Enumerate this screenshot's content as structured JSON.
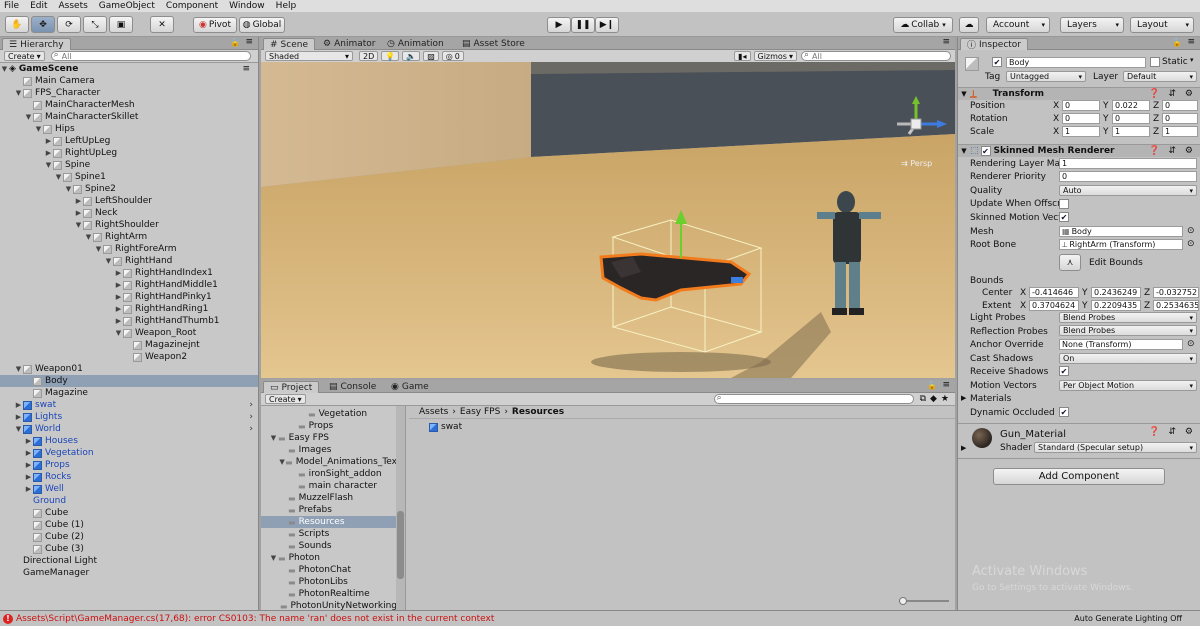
{
  "menu": [
    "File",
    "Edit",
    "Assets",
    "GameObject",
    "Component",
    "Window",
    "Help"
  ],
  "toolbar": {
    "pivot": "Pivot",
    "global": "Global",
    "collab": "Collab",
    "account": "Account",
    "layers": "Layers",
    "layout": "Layout"
  },
  "hierarchy": {
    "tab": "Hierarchy",
    "create": "Create",
    "search_placeholder": "All",
    "scene_name": "GameScene",
    "items": [
      {
        "label": "Main Camera",
        "depth": 1,
        "arrow": "",
        "blue": false
      },
      {
        "label": "FPS_Character",
        "depth": 1,
        "arrow": "▼",
        "blue": false
      },
      {
        "label": "MainCharacterMesh",
        "depth": 2,
        "arrow": "",
        "blue": false
      },
      {
        "label": "MainCharacterSkillet",
        "depth": 2,
        "arrow": "▼",
        "blue": false
      },
      {
        "label": "Hips",
        "depth": 3,
        "arrow": "▼",
        "blue": false
      },
      {
        "label": "LeftUpLeg",
        "depth": 4,
        "arrow": "▶",
        "blue": false
      },
      {
        "label": "RightUpLeg",
        "depth": 4,
        "arrow": "▶",
        "blue": false
      },
      {
        "label": "Spine",
        "depth": 4,
        "arrow": "▼",
        "blue": false
      },
      {
        "label": "Spine1",
        "depth": 5,
        "arrow": "▼",
        "blue": false
      },
      {
        "label": "Spine2",
        "depth": 6,
        "arrow": "▼",
        "blue": false
      },
      {
        "label": "LeftShoulder",
        "depth": 7,
        "arrow": "▶",
        "blue": false
      },
      {
        "label": "Neck",
        "depth": 7,
        "arrow": "▶",
        "blue": false
      },
      {
        "label": "RightShoulder",
        "depth": 7,
        "arrow": "▼",
        "blue": false
      },
      {
        "label": "RightArm",
        "depth": 8,
        "arrow": "▼",
        "blue": false
      },
      {
        "label": "RightForeArm",
        "depth": 9,
        "arrow": "▼",
        "blue": false
      },
      {
        "label": "RightHand",
        "depth": 10,
        "arrow": "▼",
        "blue": false
      },
      {
        "label": "RightHandIndex1",
        "depth": 11,
        "arrow": "▶",
        "blue": false
      },
      {
        "label": "RightHandMiddle1",
        "depth": 11,
        "arrow": "▶",
        "blue": false
      },
      {
        "label": "RightHandPinky1",
        "depth": 11,
        "arrow": "▶",
        "blue": false
      },
      {
        "label": "RightHandRing1",
        "depth": 11,
        "arrow": "▶",
        "blue": false
      },
      {
        "label": "RightHandThumb1",
        "depth": 11,
        "arrow": "▶",
        "blue": false
      },
      {
        "label": "Weapon_Root",
        "depth": 11,
        "arrow": "▼",
        "blue": false
      },
      {
        "label": "Magazinejnt",
        "depth": 12,
        "arrow": "",
        "blue": false
      },
      {
        "label": "Weapon2",
        "depth": 12,
        "arrow": "",
        "blue": false
      },
      {
        "label": "Weapon01",
        "depth": 1,
        "arrow": "▼",
        "blue": false
      },
      {
        "label": "Body",
        "depth": 2,
        "arrow": "",
        "blue": false,
        "selected": true
      },
      {
        "label": "Magazine",
        "depth": 2,
        "arrow": "",
        "blue": false
      },
      {
        "label": "swat",
        "depth": 1,
        "arrow": "▶",
        "blue": true,
        "chev": true
      },
      {
        "label": "Lights",
        "depth": 1,
        "arrow": "▶",
        "blue": true,
        "chev": true
      },
      {
        "label": "World",
        "depth": 1,
        "arrow": "▼",
        "blue": true,
        "chev": true
      },
      {
        "label": "Houses",
        "depth": 2,
        "arrow": "▶",
        "blue": true
      },
      {
        "label": "Vegetation",
        "depth": 2,
        "arrow": "▶",
        "blue": true
      },
      {
        "label": "Props",
        "depth": 2,
        "arrow": "▶",
        "blue": true
      },
      {
        "label": "Rocks",
        "depth": 2,
        "arrow": "▶",
        "blue": true
      },
      {
        "label": "Well",
        "depth": 2,
        "arrow": "▶",
        "blue": true
      },
      {
        "label": "Ground",
        "depth": 2,
        "arrow": "",
        "blue": true,
        "nocube": true
      },
      {
        "label": "Cube",
        "depth": 2,
        "arrow": "",
        "blue": false
      },
      {
        "label": "Cube (1)",
        "depth": 2,
        "arrow": "",
        "blue": false
      },
      {
        "label": "Cube (2)",
        "depth": 2,
        "arrow": "",
        "blue": false
      },
      {
        "label": "Cube (3)",
        "depth": 2,
        "arrow": "",
        "blue": false
      },
      {
        "label": "Directional Light",
        "depth": 1,
        "arrow": "",
        "blue": false,
        "nocube": true
      },
      {
        "label": "GameManager",
        "depth": 1,
        "arrow": "",
        "blue": false,
        "nocube": true
      }
    ]
  },
  "scene": {
    "tabs": [
      "Scene",
      "Animator",
      "Animation",
      "Asset Store"
    ],
    "shading": "Shaded",
    "mode_2d": "2D",
    "effects_count": "0",
    "gizmos": "Gizmos",
    "search_placeholder": "All",
    "persp_label": "Persp"
  },
  "project": {
    "tabs": [
      "Project",
      "Console",
      "Game"
    ],
    "create": "Create",
    "breadcrumb": [
      "Assets",
      "Easy FPS",
      "Resources"
    ],
    "tree": [
      {
        "label": "Vegetation",
        "depth": 3,
        "arrow": ""
      },
      {
        "label": "Props",
        "depth": 2,
        "arrow": ""
      },
      {
        "label": "Easy FPS",
        "depth": 0,
        "arrow": "▼"
      },
      {
        "label": "Images",
        "depth": 1,
        "arrow": ""
      },
      {
        "label": "Model_Animations_Tex",
        "depth": 1,
        "arrow": "▼"
      },
      {
        "label": "ironSight_addon",
        "depth": 2,
        "arrow": ""
      },
      {
        "label": "main character",
        "depth": 2,
        "arrow": ""
      },
      {
        "label": "MuzzelFlash",
        "depth": 1,
        "arrow": ""
      },
      {
        "label": "Prefabs",
        "depth": 1,
        "arrow": ""
      },
      {
        "label": "Resources",
        "depth": 1,
        "arrow": "",
        "selected": true
      },
      {
        "label": "Scripts",
        "depth": 1,
        "arrow": ""
      },
      {
        "label": "Sounds",
        "depth": 1,
        "arrow": ""
      },
      {
        "label": "Photon",
        "depth": 0,
        "arrow": "▼"
      },
      {
        "label": "PhotonChat",
        "depth": 1,
        "arrow": ""
      },
      {
        "label": "PhotonLibs",
        "depth": 1,
        "arrow": ""
      },
      {
        "label": "PhotonRealtime",
        "depth": 1,
        "arrow": ""
      },
      {
        "label": "PhotonUnityNetworking",
        "depth": 1,
        "arrow": ""
      }
    ],
    "assets": [
      "swat"
    ]
  },
  "inspector": {
    "tab": "Inspector",
    "object_name": "Body",
    "static_label": "Static",
    "tag_label": "Tag",
    "tag_value": "Untagged",
    "layer_label": "Layer",
    "layer_value": "Default",
    "transform": {
      "title": "Transform",
      "rows": [
        {
          "label": "Position",
          "x": "0",
          "y": "0.022",
          "z": "0"
        },
        {
          "label": "Rotation",
          "x": "0",
          "y": "0",
          "z": "0"
        },
        {
          "label": "Scale",
          "x": "1",
          "y": "1",
          "z": "1"
        }
      ]
    },
    "smr": {
      "title": "Skinned Mesh Renderer",
      "rendering_layer_mask": "Rendering Layer Mas",
      "rendering_layer_mask_value": "1",
      "renderer_priority": "Renderer Priority",
      "renderer_priority_value": "0",
      "quality": "Quality",
      "quality_value": "Auto",
      "update_offscreen": "Update When Offscre",
      "skinned_motion": "Skinned Motion Vecto",
      "mesh": "Mesh",
      "mesh_value": "Body",
      "root_bone": "Root Bone",
      "root_bone_value": "RightArm (Transform)",
      "edit_bounds": "Edit Bounds",
      "bounds": "Bounds",
      "center": "Center",
      "center_x": "-0.414646",
      "center_y": "0.2436249",
      "center_z": "-0.032752",
      "extent": "Extent",
      "extent_x": "0.3704624",
      "extent_y": "0.2209435",
      "extent_z": "0.2534635",
      "light_probes": "Light Probes",
      "light_probes_value": "Blend Probes",
      "reflection_probes": "Reflection Probes",
      "reflection_probes_value": "Blend Probes",
      "anchor_override": "Anchor Override",
      "anchor_override_value": "None (Transform)",
      "cast_shadows": "Cast Shadows",
      "cast_shadows_value": "On",
      "receive_shadows": "Receive Shadows",
      "motion_vectors": "Motion Vectors",
      "motion_vectors_value": "Per Object Motion",
      "materials": "Materials",
      "dynamic_occluded": "Dynamic Occluded"
    },
    "material": {
      "name": "Gun_Material",
      "shader_label": "Shader",
      "shader_value": "Standard (Specular setup)"
    },
    "add_component": "Add Component",
    "watermark_title": "Activate Windows",
    "watermark_sub": "Go to Settings to activate Windows."
  },
  "status": {
    "error": "Assets\\Script\\GameManager.cs(17,68): error CS0103: The name 'ran' does not exist in the current context",
    "right": "Auto Generate Lighting Off"
  }
}
